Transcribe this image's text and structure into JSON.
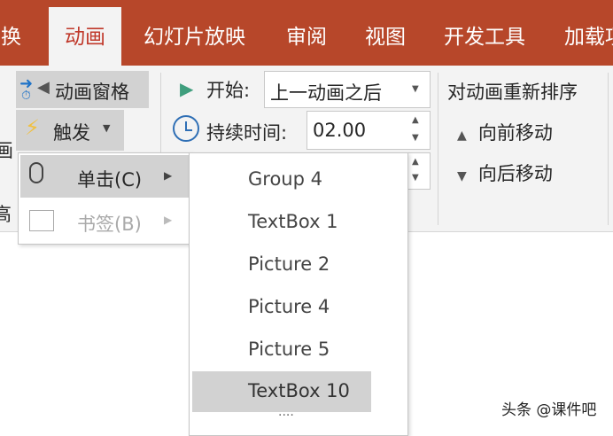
{
  "tabs": [
    {
      "label": "切换"
    },
    {
      "label": "动画"
    },
    {
      "label": "幻灯片放映"
    },
    {
      "label": "审阅"
    },
    {
      "label": "视图"
    },
    {
      "label": "开发工具"
    },
    {
      "label": "加载项"
    }
  ],
  "ribbon": {
    "animation_pane": "动画窗格",
    "trigger": "触发",
    "start_label": "开始:",
    "start_value": "上一动画之后",
    "duration_label": "持续时间:",
    "duration_value": "02.00",
    "reorder_title": "对动画重新排序",
    "move_earlier": "向前移动",
    "move_later": "向后移动",
    "left_cut_1": "画",
    "left_cut_2": "高"
  },
  "trigger_menu": {
    "items": [
      {
        "label": "单击(C)"
      },
      {
        "label": "书签(B)"
      }
    ]
  },
  "submenu": {
    "items": [
      {
        "label": "Group 4"
      },
      {
        "label": "TextBox 1"
      },
      {
        "label": "Picture 2"
      },
      {
        "label": "Picture 4"
      },
      {
        "label": "Picture 5"
      },
      {
        "label": "TextBox 10"
      }
    ],
    "more": "····"
  },
  "watermark": "头条 @课件吧",
  "colors": {
    "tabbar": "#b7472a",
    "ribbon": "#f3f3f3",
    "highlight": "#d2d2d2"
  }
}
